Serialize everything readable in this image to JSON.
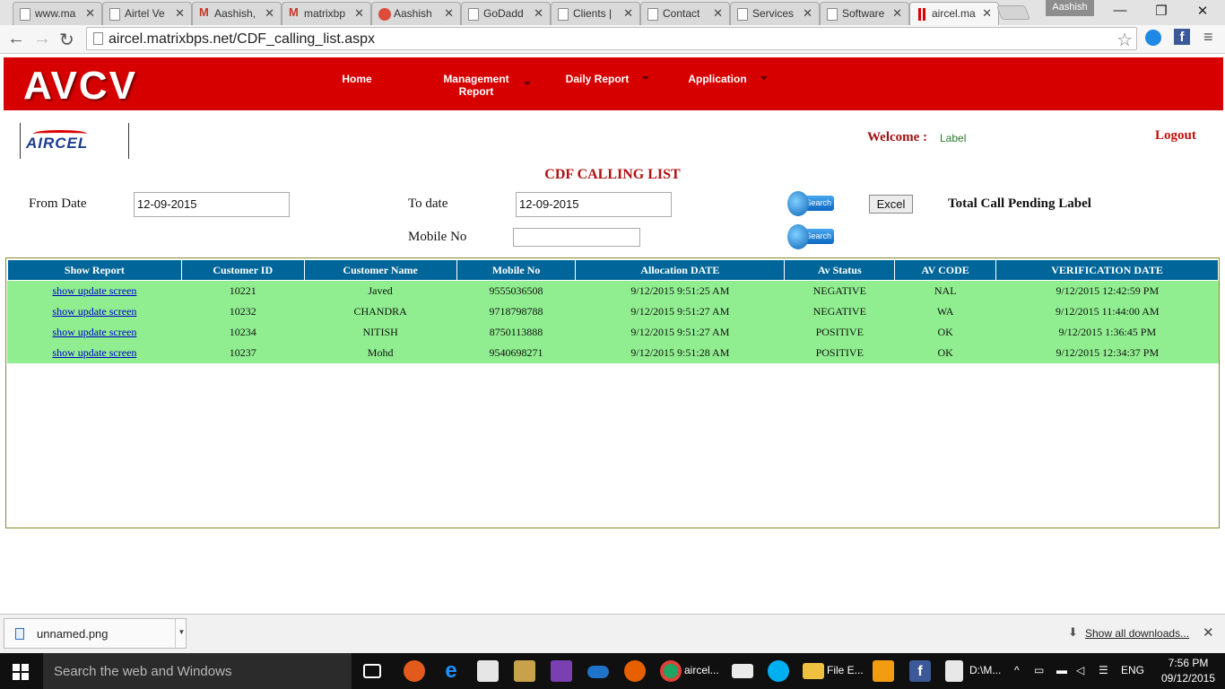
{
  "browser": {
    "tabs": [
      {
        "label": "www.ma",
        "icon": "page-icon"
      },
      {
        "label": "Airtel Ve",
        "icon": "page-icon"
      },
      {
        "label": "Aashish,",
        "icon": "gmail-icon"
      },
      {
        "label": "matrixbp",
        "icon": "gmail-icon"
      },
      {
        "label": "Aashish",
        "icon": "google-plus-icon"
      },
      {
        "label": "GoDadd",
        "icon": "godaddy-icon"
      },
      {
        "label": "Clients |",
        "icon": "page-icon"
      },
      {
        "label": "Contact",
        "icon": "page-icon"
      },
      {
        "label": "Services",
        "icon": "page-icon"
      },
      {
        "label": "Software",
        "icon": "page-icon"
      },
      {
        "label": "aircel.ma",
        "icon": "aircel-icon",
        "active": true
      }
    ],
    "profile_name": "Aashish",
    "url": "aircel.matrixbps.net/CDF_calling_list.aspx"
  },
  "header": {
    "logo": "AVCV",
    "nav": [
      {
        "label": "Home"
      },
      {
        "label": "Management Report"
      },
      {
        "label": "Daily Report"
      },
      {
        "label": "Application"
      }
    ],
    "brand_color": "#d60000"
  },
  "brand_logo": "AIRCEL",
  "user": {
    "welcome_label": "Welcome :",
    "welcome_value": "Label",
    "logout": "Logout"
  },
  "page_title": "CDF CALLING LIST",
  "filters": {
    "from_date_label": "From Date",
    "from_date_value": "12-09-2015",
    "to_date_label": "To date",
    "to_date_value": "12-09-2015",
    "mobile_label": "Mobile No",
    "mobile_value": "",
    "search_label": "Search",
    "excel_label": "Excel",
    "total_pending_label": "Total Call Pending",
    "total_pending_value": "Label"
  },
  "grid": {
    "columns": [
      "Show Report",
      "Customer ID",
      "Customer Name",
      "Mobile No",
      "Allocation DATE",
      "Av Status",
      "AV CODE",
      "VERIFICATION DATE"
    ],
    "rows": [
      [
        "show update screen",
        "10221",
        "Javed",
        "9555036508",
        "9/12/2015 9:51:25 AM",
        "NEGATIVE",
        "NAL",
        "9/12/2015 12:42:59 PM"
      ],
      [
        "show update screen",
        "10232",
        "CHANDRA",
        "9718798788",
        "9/12/2015 9:51:27 AM",
        "NEGATIVE",
        "WA",
        "9/12/2015 11:44:00 AM"
      ],
      [
        "show update screen",
        "10234",
        "NITISH",
        "8750113888",
        "9/12/2015 9:51:27 AM",
        "POSITIVE",
        "OK",
        "9/12/2015 1:36:45 PM"
      ],
      [
        "show update screen",
        "10237",
        "Mohd",
        "9540698271",
        "9/12/2015 9:51:28 AM",
        "POSITIVE",
        "OK",
        "9/12/2015 12:34:37 PM"
      ]
    ],
    "header_color": "#006699",
    "row_color": "#90ee90"
  },
  "downloads": {
    "file_name": "unnamed.png",
    "show_all": "Show all downloads..."
  },
  "taskbar": {
    "search_placeholder": "Search the web and Windows",
    "chrome_label": "aircel...",
    "explorer_label": "File E...",
    "doc_label": "D:\\M...",
    "language": "ENG",
    "time": "7:56 PM",
    "date": "09/12/2015"
  }
}
